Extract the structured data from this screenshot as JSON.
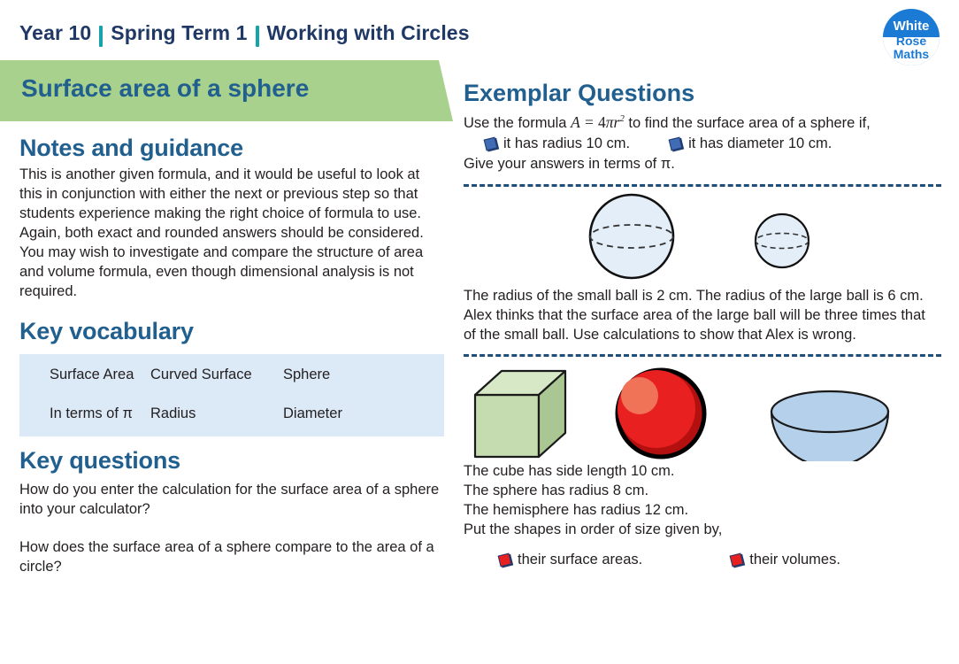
{
  "header": {
    "year": "Year 10",
    "term": "Spring Term 1",
    "topic": "Working with Circles",
    "logo": {
      "line1": "White",
      "line2": "Rose",
      "line3": "Maths"
    }
  },
  "banner": {
    "title": "Surface area of a sphere",
    "color": "#a9d18e"
  },
  "left": {
    "notes_heading": "Notes and guidance",
    "notes_text": "This is another given formula, and it would be useful to look at this in conjunction with either the next or previous step so that students experience making the right choice of formula to use. Again, both exact and rounded answers should be considered. You may wish to investigate and compare the structure of area and volume formula, even though dimensional analysis is not required.",
    "vocab_heading": "Key vocabulary",
    "vocab_rows": [
      [
        "Surface Area",
        "Curved Surface",
        "Sphere"
      ],
      [
        "In terms of π",
        "Radius",
        "Diameter"
      ]
    ],
    "questions_heading": "Key questions",
    "questions": [
      "How do you enter the calculation for the surface area of a sphere into your calculator?",
      "How does the surface area of a sphere compare to the area of a circle?"
    ]
  },
  "right": {
    "heading": "Exemplar Questions",
    "q1": {
      "intro_before": "Use the formula ",
      "formula": "A = 4πr²",
      "intro_after": " to find the surface area of a sphere if,",
      "bullets": [
        "it has radius 10 cm.",
        "it has diameter 10 cm."
      ],
      "outro": "Give your answers in terms of π."
    },
    "q2": {
      "lines": [
        "The radius of the small ball is 2 cm. The radius of the large ball is 6 cm.",
        "Alex thinks that the surface area of the large ball will be three times that of the small ball. Use calculations to show that Alex is wrong."
      ],
      "figures": [
        "large-sphere",
        "small-sphere"
      ]
    },
    "q3": {
      "lines": [
        "The cube has side length 10 cm.",
        "The sphere has radius 8 cm.",
        "The hemisphere has radius 12 cm.",
        "Put the shapes in order of size given by,"
      ],
      "bullets": [
        "their surface areas.",
        "their volumes."
      ],
      "figures": [
        "cube",
        "red-sphere",
        "hemisphere"
      ]
    }
  },
  "colors": {
    "heading_blue": "#215f8e",
    "title_navy": "#1f3864",
    "teal_divider": "#16a3ac",
    "banner_green": "#a9d18e",
    "vocab_bg": "#dce9f7",
    "dashed_rule": "#1f4e79",
    "bullet_blue": "#3f6cb5",
    "bullet_red": "#e8201f",
    "sphere_fill": "#e4eef8",
    "cube_fill": "#c5dcb0",
    "hemisphere_fill": "#b4d0ea",
    "red_sphere": "#e8201f"
  }
}
